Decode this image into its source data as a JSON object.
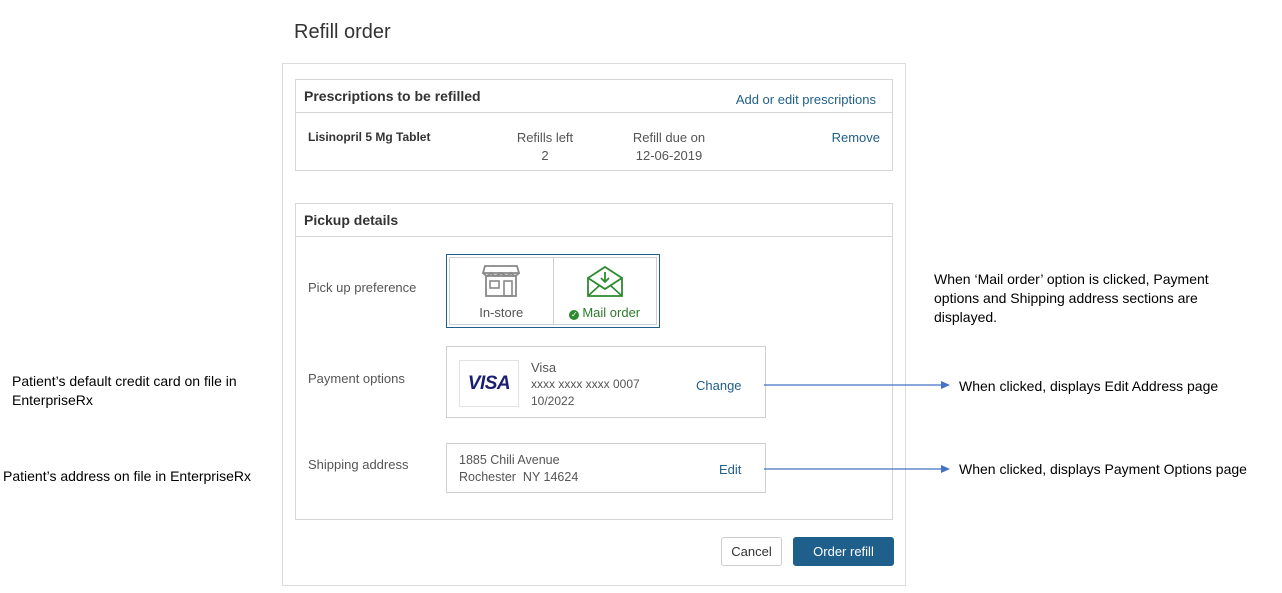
{
  "page": {
    "title": "Refill order"
  },
  "prescriptions": {
    "header": "Prescriptions to be refilled",
    "add_edit_link": "Add or edit prescriptions",
    "items": [
      {
        "name": "Lisinopril 5 Mg Tablet",
        "refills_label": "Refills left",
        "refills_value": "2",
        "due_label": "Refill due on",
        "due_value": "12-06-2019",
        "remove_label": "Remove"
      }
    ]
  },
  "pickup": {
    "header": "Pickup details",
    "preference_label": "Pick up preference",
    "options": [
      {
        "label": "In-store",
        "icon": "store-icon",
        "selected": false
      },
      {
        "label": "Mail order",
        "icon": "mail-icon",
        "selected": true
      }
    ],
    "payment_label": "Payment options",
    "payment": {
      "brand": "Visa",
      "logo_text": "VISA",
      "number": "xxxx xxxx xxxx 0007",
      "expiry": "10/2022",
      "change_label": "Change"
    },
    "shipping_label": "Shipping address",
    "shipping": {
      "line1": "1885 Chili Avenue",
      "line2": "Rochester  NY 14624",
      "edit_label": "Edit"
    }
  },
  "actions": {
    "cancel_label": "Cancel",
    "order_label": "Order refill"
  },
  "annotations": {
    "left_card": "Patient’s default credit card on file in EnterpriseRx",
    "left_address": "Patient’s address on file in EnterpriseRx",
    "right_mail": "When ‘Mail order’ option is clicked, Payment options and Shipping address sections are displayed.",
    "right_change": "When clicked, displays Edit Address page",
    "right_edit": "When clicked, displays Payment Options page"
  },
  "colors": {
    "accent": "#1f5f8b",
    "mail_green": "#2d7a2d",
    "annotation_arrow": "#4472c4"
  }
}
